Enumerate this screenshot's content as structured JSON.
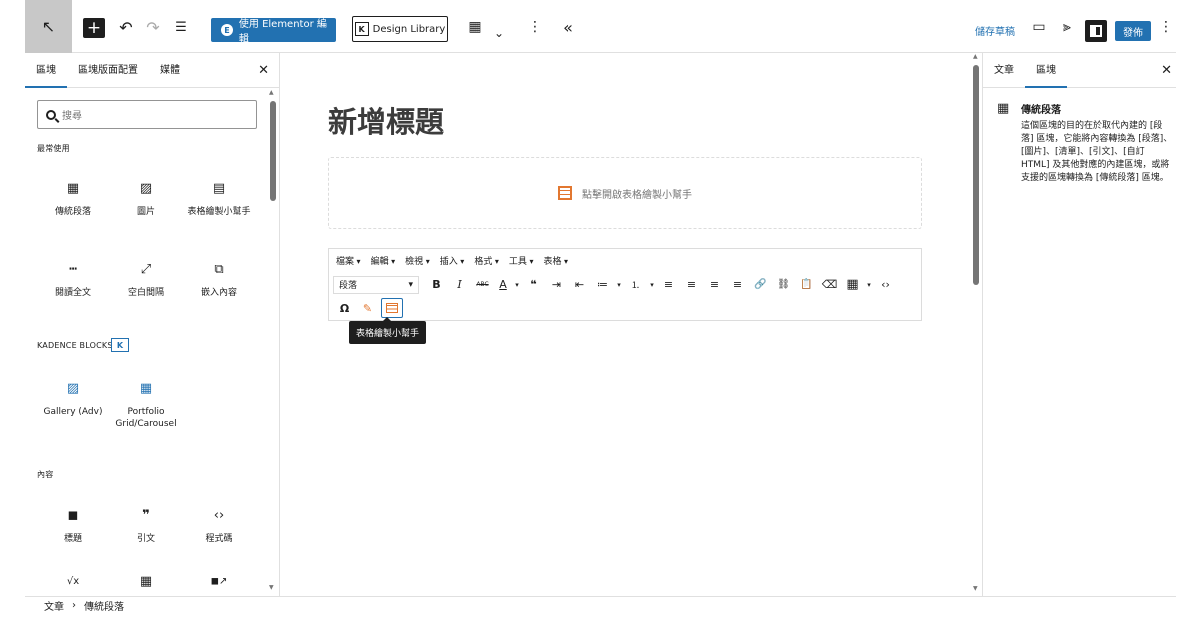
{
  "topbar": {
    "back_icon": "↖",
    "add_icon": "+",
    "undo_icon": "↶",
    "redo_icon": "↷",
    "list_view_icon": "☰",
    "elementor_badge": "E",
    "elementor_label": "使用 Elementor 編輯",
    "design_library_badge": "K",
    "design_library_label": "Design Library",
    "table_icon": "▦",
    "chevron_icon": "⌄",
    "more_icon": "⋮",
    "collapse_icon": "«",
    "save_draft": "儲存草稿",
    "preview_icon": "▭",
    "kadence_icon": "⫸",
    "publish": "發佈",
    "options_icon": "⋮"
  },
  "left_panel": {
    "tabs": [
      "區塊",
      "區塊版面配置",
      "媒體"
    ],
    "close_icon": "✕",
    "search_placeholder": "搜尋",
    "sections": {
      "frequent": "最常使用",
      "kadence": "KADENCE BLOCKS",
      "kadence_badge": "K",
      "content": "內容"
    },
    "frequent_blocks": [
      {
        "label": "傳統段落",
        "icon": "▦"
      },
      {
        "label": "圖片",
        "icon": "▨"
      },
      {
        "label": "表格繪製小幫手",
        "icon": "▤"
      },
      {
        "label": "閱讀全文",
        "icon": "┅"
      },
      {
        "label": "空白間隔",
        "icon": "⤢"
      },
      {
        "label": "嵌入內容",
        "icon": "⧉"
      }
    ],
    "kadence_blocks": [
      {
        "label": "Gallery (Adv)",
        "icon": "▨"
      },
      {
        "label": "Portfolio Grid/Carousel",
        "icon": "▦"
      }
    ],
    "content_blocks": [
      {
        "label": "標題",
        "icon": "◼"
      },
      {
        "label": "引文",
        "icon": "❞"
      },
      {
        "label": "程式碼",
        "icon": "‹›"
      },
      {
        "label": "",
        "icon": "√x"
      },
      {
        "label": "",
        "icon": "▦"
      },
      {
        "label": "",
        "icon": "◼↗"
      }
    ]
  },
  "canvas": {
    "title": "新增標題",
    "placeholder": "點擊開啟表格繪製小幫手",
    "menu": [
      "檔案",
      "編輯",
      "檢視",
      "插入",
      "格式",
      "工具",
      "表格"
    ],
    "format_select": "段落",
    "tools": [
      "B",
      "I",
      "ABC",
      "A",
      "❝",
      "⇥",
      "⇤",
      "≔",
      "⒈",
      "≡",
      "≡",
      "≡",
      "≡",
      "🔗",
      "⛓",
      "📋",
      "⌫",
      "▦",
      "‹›"
    ],
    "tooltip": "表格繪製小幫手"
  },
  "right_panel": {
    "tabs": [
      "文章",
      "區塊"
    ],
    "close_icon": "✕",
    "block_icon": "▦",
    "block_title": "傳統段落",
    "block_desc": "這個區塊的目的在於取代內建的 [段落] 區塊，它能將內容轉換為 [段落]、[圖片]、[清單]、[引文]、[自訂 HTML] 及其他對應的內建區塊，或將支援的區塊轉換為 [傳統段落] 區塊。"
  },
  "breadcrumb": {
    "root": "文章",
    "sep": "›",
    "current": "傳統段落"
  },
  "colors": {
    "accent": "#2271b1",
    "plugin_orange": "#e27730"
  }
}
